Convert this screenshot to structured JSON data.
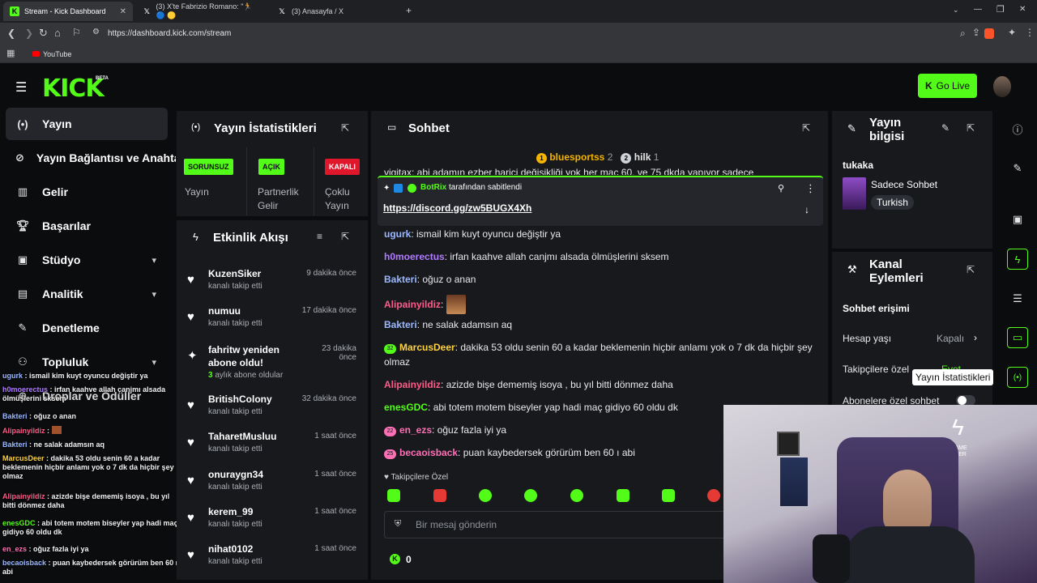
{
  "browser": {
    "tabs": [
      {
        "title": "Stream - Kick Dashboard",
        "active": true
      },
      {
        "title": "(3) X'te Fabrizio Romano: \"🏃 🔵 🟡"
      },
      {
        "title": "(3) Anasayfa / X"
      }
    ],
    "new_tab": "+",
    "url": "https://dashboard.kick.com/stream",
    "bookmark": "YouTube"
  },
  "kick": {
    "logo": "KICK",
    "beta": "BETA",
    "go_live": "Go Live",
    "accent": "#53fc18"
  },
  "sidebar": {
    "items": [
      {
        "label": "Yayın",
        "icon": "broadcast-icon"
      },
      {
        "label": "Yayın Bağlantısı ve Anahtarı",
        "icon": "link-icon"
      },
      {
        "label": "Gelir",
        "icon": "bar-chart-icon"
      },
      {
        "label": "Başarılar",
        "icon": "trophy-icon"
      },
      {
        "label": "Stüdyo",
        "icon": "studio-icon"
      },
      {
        "label": "Analitik",
        "icon": "analytics-icon"
      },
      {
        "label": "Denetleme",
        "icon": "moderation-icon"
      },
      {
        "label": "Topluluk",
        "icon": "community-icon"
      },
      {
        "label": "Droplar ve Ödüller",
        "icon": "gift-icon"
      }
    ]
  },
  "stats": {
    "title": "Yayın İstatistikleri",
    "cards": [
      {
        "badge": "SORUNSUZ",
        "label": "Yayın",
        "color": "#53fc18"
      },
      {
        "badge": "AÇIK",
        "label": "Partnerlik Gelir",
        "color": "#53fc18"
      },
      {
        "badge": "KAPALI",
        "label": "Çoklu Yayın",
        "color": "#e0162b"
      }
    ]
  },
  "events": {
    "title": "Etkinlik Akışı",
    "items": [
      {
        "name": "KuzenSiker",
        "sub": "kanalı takip etti",
        "time": "9 dakika önce",
        "icon": "heart-icon"
      },
      {
        "name": "numuu",
        "sub": "kanalı takip etti",
        "time": "17 dakika önce",
        "icon": "heart-icon"
      },
      {
        "name": "fahritw yeniden abone oldu!",
        "sub_count": "3",
        "sub": "aylık abone oldular",
        "time": "23 dakika önce",
        "icon": "sparkle-icon"
      },
      {
        "name": "BritishColony",
        "sub": "kanalı takip etti",
        "time": "32 dakika önce",
        "icon": "heart-icon"
      },
      {
        "name": "TaharetMusluu",
        "sub": "kanalı takip etti",
        "time": "1 saat önce",
        "icon": "heart-icon"
      },
      {
        "name": "onuraygn34",
        "sub": "kanalı takip etti",
        "time": "1 saat önce",
        "icon": "heart-icon"
      },
      {
        "name": "kerem_99",
        "sub": "kanalı takip etti",
        "time": "1 saat önce",
        "icon": "heart-icon"
      },
      {
        "name": "nihat0102",
        "sub": "kanalı takip etti",
        "time": "1 saat önce",
        "icon": "heart-icon"
      }
    ]
  },
  "chat": {
    "title": "Sohbet",
    "top_gifters": [
      {
        "name": "bluesportss",
        "count": "2"
      },
      {
        "name": "hilk",
        "count": "1"
      }
    ],
    "cut_line": "vigitax: abi adamın ezber harici değişikliği yok her maç 60. ve 75 dkda yapıyor sadece",
    "pinned": {
      "by": "BotRix",
      "suffix": "tarafından sabitlendi",
      "link": "https://discord.gg/zw5BUGX4Xh"
    },
    "messages": [
      {
        "user": "ugurk",
        "text": "ismail kim kuyt oyuncu değiştir ya",
        "color": "#9bb8ff"
      },
      {
        "user": "h0moerectus",
        "text": "irfan kaahve allah canjmı alsada ölmüşlerini sksem",
        "color": "#b07bff"
      },
      {
        "user": "Bakteri",
        "text": "oğuz o anan",
        "color": "#9bb8ff"
      },
      {
        "user": "Alipainyildiz",
        "text": "",
        "color": "#ff5c8a"
      },
      {
        "user": "Bakteri",
        "text": "ne salak adamsın aq",
        "color": "#9bb8ff"
      },
      {
        "user": "MarcusDeer",
        "badge": "32",
        "text": "dakika 53 oldu senin 60 a kadar beklemenin hiçbir anlamı yok o 7 dk da hiçbir şey olmaz",
        "color": "#ffd23f"
      },
      {
        "user": "Alipainyildiz",
        "text": "azizde bişe dememiş isoya , bu yıl bitti dönmez daha",
        "color": "#ff5c8a"
      },
      {
        "user": "enesGDC",
        "text": "abi totem motem biseyler yap hadi maç gidiyo 60 oldu dk",
        "color": "#53fc18"
      },
      {
        "user": "en_ezs",
        "badge": "22",
        "text": "oğuz fazla iyi ya",
        "color": "#ff6fb5"
      },
      {
        "user": "becaoisback",
        "badge": "25",
        "text": "puan kaybedersek görürüm ben 60 ı abi",
        "color": "#ff6fb5"
      }
    ],
    "follower_only": "Takipçilere Özel",
    "placeholder": "Bir mesaj gönderin",
    "points": "0"
  },
  "info": {
    "title": "Yayın bilgisi",
    "streamer": "tukaka",
    "category": "Sadece Sohbet",
    "language": "Turkish"
  },
  "actions": {
    "title": "Kanal Eylemleri",
    "section": "Sohbet erişimi",
    "rows": [
      {
        "label": "Hesap yaşı",
        "value": "Kapalı"
      },
      {
        "label": "Takipçilere özel",
        "value": "Evet"
      },
      {
        "label": "Abonelere özel sohbet",
        "value": ""
      }
    ],
    "tooltip": "Yayın İstatistikleri"
  },
  "overlay_chat": [
    {
      "user": "ugurk",
      "text": "ismail kim kuyt oyuncu değiştir ya",
      "color": "#9bb8ff"
    },
    {
      "user": "h0moerectus",
      "text": "irfan kaahve allah canjmı alsada ölmüşlerini sksem",
      "color": "#b07bff"
    },
    {
      "user": "Bakteri",
      "text": "oğuz o anan",
      "color": "#9bb8ff"
    },
    {
      "user": "Alipainyildiz",
      "text": "",
      "color": "#ff5c8a"
    },
    {
      "user": "Bakteri",
      "text": "ne salak adamsın aq",
      "color": "#9bb8ff"
    },
    {
      "user": "MarcusDeer",
      "text": "dakika 53 oldu senin 60 a kadar beklemenin hiçbir anlamı yok o 7 dk da hiçbir şey olmaz",
      "color": "#ffd23f"
    },
    {
      "user": "Alipainyildiz",
      "text": "azizde bişe dememiş isoya , bu yıl bitti dönmez daha",
      "color": "#ff5c8a"
    },
    {
      "user": "enesGDC",
      "text": "abi totem motem biseyler yap hadi maç gidiyo 60 oldu dk",
      "color": "#53fc18"
    },
    {
      "user": "en_ezs",
      "text": "oğuz fazla iyi ya",
      "color": "#ff6fb5"
    },
    {
      "user": "becaoisback",
      "text": "puan kaybedersek görürüm ben 60 ı abi",
      "color": "#9bb8ff"
    }
  ],
  "webcam": {
    "sign": "GAME OVER"
  }
}
